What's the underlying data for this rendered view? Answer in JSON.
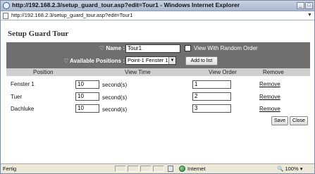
{
  "window": {
    "title": "http://192.168.2.3/setup_guard_tour.asp?edit=Tour1 - Windows Internet Explorer",
    "minimize_glyph": "_",
    "maximize_glyph": "□",
    "close_glyph": "x"
  },
  "address": {
    "url": "http://192.168.2.3/setup_guard_tour.asp?edit=Tour1",
    "dropdown_glyph": "▼"
  },
  "page": {
    "title": "Setup Guard Tour"
  },
  "form": {
    "heart_glyph": "♡",
    "name_label": "Name :",
    "name_value": "Tour1",
    "positions_label": "Available Positions :",
    "positions_selected": "Point-1  Fenster 1",
    "select_arrow": "▼",
    "random_order_label": "View With Random Order",
    "add_button": "Add to list"
  },
  "table": {
    "headers": [
      "Position",
      "View Time",
      "View Order",
      "Remove"
    ],
    "rows": [
      {
        "position": "Fenster 1",
        "time": "10",
        "unit": "second(s)",
        "order": "1",
        "remove": "Remove"
      },
      {
        "position": "Tuer",
        "time": "10",
        "unit": "second(s)",
        "order": "2",
        "remove": "Remove"
      },
      {
        "position": "Dachluke",
        "time": "10",
        "unit": "second(s)",
        "order": "3",
        "remove": "Remove"
      }
    ]
  },
  "actions": {
    "save": "Save",
    "close": "Close"
  },
  "statusbar": {
    "status": "Fertig",
    "zone": "Internet",
    "zoom": "100%",
    "zoom_icon": "🔍",
    "zoom_arrow": "▾"
  },
  "colors": {
    "panel": "#6f6f6f",
    "table_header": "#cfcfcf",
    "titlebar": "#b7c4d8"
  }
}
